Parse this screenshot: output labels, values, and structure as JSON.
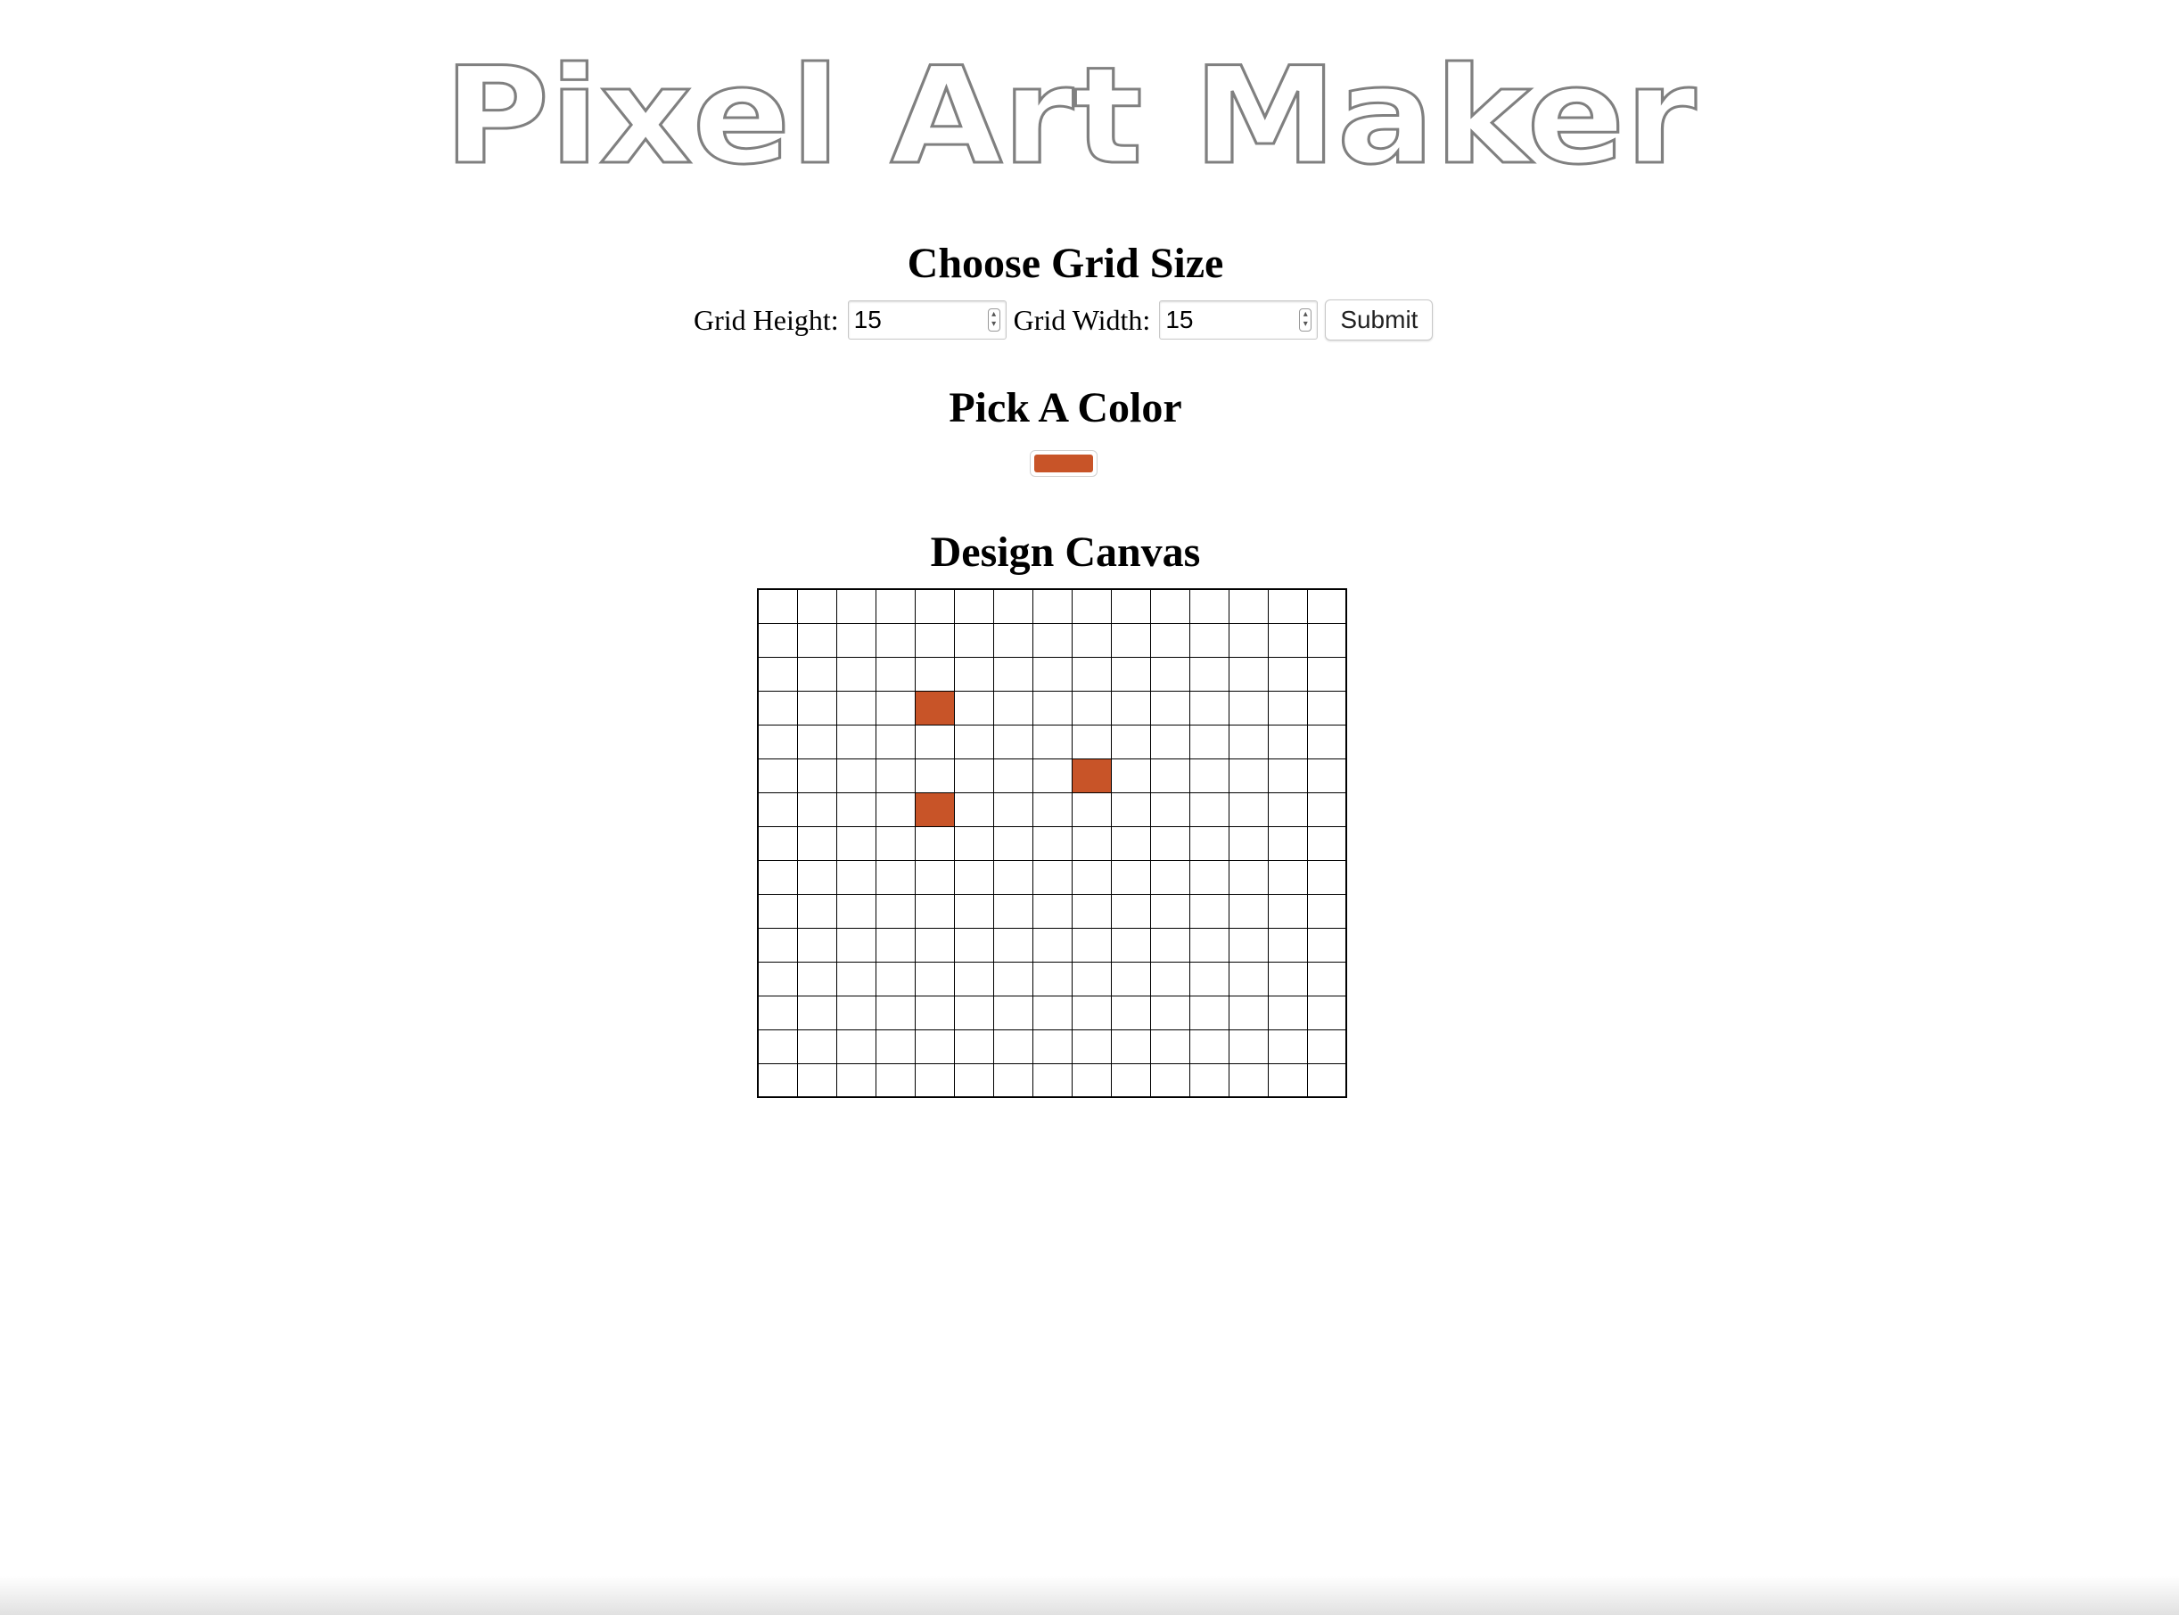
{
  "header": {
    "title": "Pixel Art Maker"
  },
  "grid_size": {
    "heading": "Choose Grid Size",
    "height_label": "Grid Height:",
    "height_value": "15",
    "width_label": "Grid Width:",
    "width_value": "15",
    "submit_label": "Submit"
  },
  "color": {
    "heading": "Pick A Color",
    "selected": "#c85428"
  },
  "canvas": {
    "heading": "Design Canvas",
    "rows": 15,
    "cols": 15,
    "painted": [
      {
        "row": 3,
        "col": 4
      },
      {
        "row": 5,
        "col": 8
      },
      {
        "row": 6,
        "col": 4
      }
    ]
  },
  "colors": {
    "title_stroke": "#808080",
    "cell_border": "#000000",
    "background": "#ffffff"
  }
}
